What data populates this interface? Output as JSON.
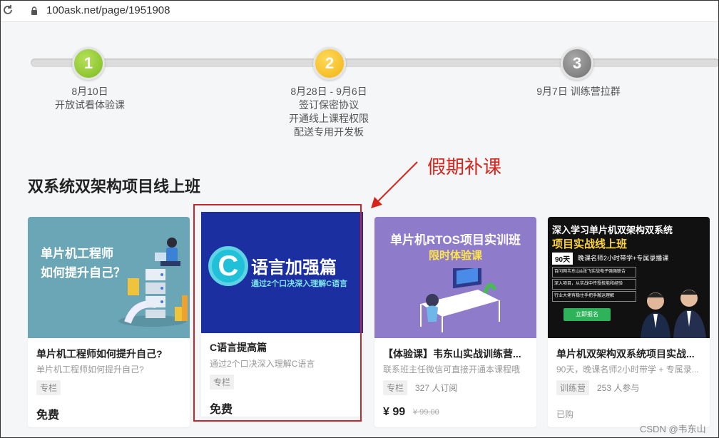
{
  "browser": {
    "url": "100ask.net/page/1951908"
  },
  "timeline": [
    {
      "num": "1",
      "lines": [
        "8月10日",
        "开放试看体验课"
      ]
    },
    {
      "num": "2",
      "lines": [
        "8月28日 - 9月6日",
        "签订保密协议",
        "开通线上课程权限",
        "配送专用开发板"
      ]
    },
    {
      "num": "3",
      "lines": [
        "9月7日 训练营拉群"
      ]
    }
  ],
  "annotation": {
    "text": "假期补课",
    "color": "#d8231b"
  },
  "section": {
    "title": "双系统双架构项目线上班"
  },
  "cards": [
    {
      "title": "单片机工程师如何提升自己?",
      "subtitle": "单片机工程师如何提升自己?",
      "tag": "专栏",
      "count": "",
      "price": "免费",
      "original": "",
      "status": "",
      "cover": {
        "line1": "单片机工程师",
        "line2": "如何提升自己？",
        "bg": "#6aa6b6"
      }
    },
    {
      "title": "C语言提高篇",
      "subtitle": "通过2个口决深入理解C语言",
      "tag": "专栏",
      "count": "",
      "price": "免费",
      "original": "",
      "status": "",
      "cover": {
        "letter": "C",
        "line1": "语言加强篇",
        "line2": "通过2个口决深入理解C语言",
        "bg": "#1c2fa0"
      }
    },
    {
      "title": "【体验课】韦东山实战训练营...",
      "subtitle": "联系班主任微信可直接开通本课程哦",
      "tag": "专栏",
      "count": "327 人订阅",
      "price": "¥ 99",
      "original": "¥ 99.00",
      "status": "",
      "cover": {
        "line1": "单片机RTOS项目实训班",
        "line2": "限时体验课",
        "bg": "#8e7bc9"
      }
    },
    {
      "title": "单片机双架构双系统项目实战...",
      "subtitle": "90天，晚课名师2小时带学 + 专属录...",
      "tag": "训练营",
      "count": "253 人参与",
      "price": "",
      "original": "",
      "status": "已购",
      "cover": {
        "line1": "深入学习单片机双架构双系统",
        "line2": "项目实战线上班",
        "badge": "90天",
        "badge_text": "晚课名师2小时带学+专属录播课",
        "bullets": [
          "百问网韦东山&张飞实战电子强强联合",
          "深入项目，从实战中传授技能和经验",
          "行业大佬有稳住手把手搬运理解"
        ],
        "btn": "立即报名",
        "bg": "#111"
      }
    }
  ],
  "footer": {
    "watermark": "CSDN @韦东山"
  }
}
